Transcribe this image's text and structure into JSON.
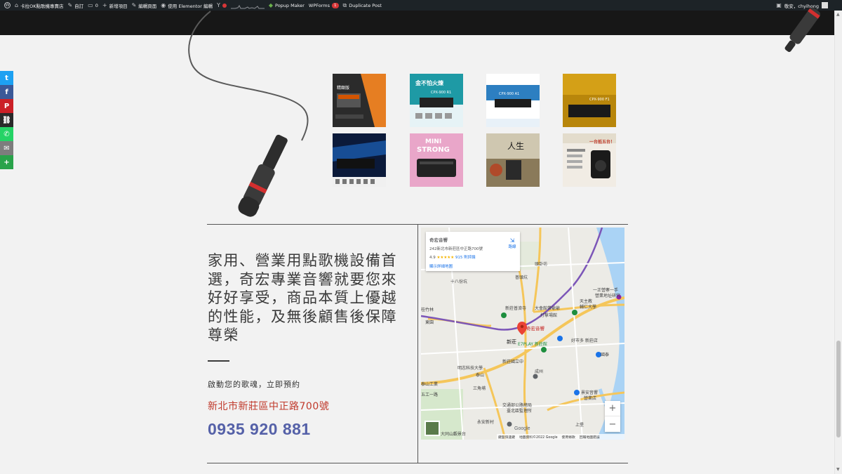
{
  "adminbar": {
    "site_name": "卡拉OK點歌機專賣店",
    "customize": "自訂",
    "comments_count": "0",
    "new_item": "新增項目",
    "edit_page": "編輯頁面",
    "elementor_edit": "使用 Elementor 編輯",
    "popup_maker": "Popup Maker",
    "wpforms": "WPForms",
    "wpforms_badge": "1",
    "duplicate_post": "Duplicate Post",
    "greeting": "敬安，chyihong"
  },
  "share_buttons": [
    {
      "name": "twitter",
      "glyph": "t",
      "color": "#1da1f2"
    },
    {
      "name": "facebook",
      "glyph": "f",
      "color": "#3b5998"
    },
    {
      "name": "pinterest",
      "glyph": "P",
      "color": "#cb2027"
    },
    {
      "name": "copy-link",
      "glyph": "⛓",
      "color": "#2a2a2a"
    },
    {
      "name": "whatsapp",
      "glyph": "✆",
      "color": "#25d366"
    },
    {
      "name": "email",
      "glyph": "✉",
      "color": "#7d7d7d"
    },
    {
      "name": "more",
      "glyph": "+",
      "color": "#29a34a"
    }
  ],
  "gallery": {
    "row1": [
      "gallery-image-1",
      "gallery-image-2",
      "gallery-image-3",
      "gallery-image-4"
    ],
    "row2": [
      "gallery-image-5",
      "gallery-image-6",
      "gallery-image-7",
      "gallery-image-8"
    ],
    "thumb_texts": {
      "t1": "精緻版",
      "t2": "金不怕火煉",
      "t2b": "CPX-900 R1",
      "t3": "CPX-900 A1",
      "t4": "CPX-900 F1",
      "t6a": "MINI",
      "t6b": "STRONG",
      "t7": "人生",
      "t8": "一台抵五台！"
    }
  },
  "contact": {
    "headline": "家用、營業用點歌機設備首選，奇宏專業音響就要您來好好享受，商品本質上優越的性能，及無後顧售後保障尊榮",
    "subline": "啟動您的歌魂，立即預約",
    "address": "新北市新莊區中正路700號",
    "phone": "0935 920 881"
  },
  "map": {
    "place_name": "奇宏音響",
    "place_address": "242新北市新莊區中正路700號",
    "rating": "4.9",
    "stars": "★★★★★",
    "reviews": "915 則評論",
    "larger_map": "顯示詳細地圖",
    "directions": "路線",
    "marker_label": "奇宏音響",
    "labels": {
      "new_taipei": "新北市立",
      "toucheng": "頭卦坊",
      "fulong": "福林",
      "st_fair": "十八份坑",
      "pu_jiang": "普頭坑",
      "tianzhu": "天主教",
      "fu_jen": "輔仁大學",
      "fu_jen2": "一正營寨一手",
      "fu_jen3": "營業地址研究",
      "xinzhuang_station": "新莊",
      "xinzhuang_school": "新莊國立中",
      "chengzhou": "成州",
      "kaishan": "凱旋",
      "mingzhi": "明志科技大學",
      "taishan": "泰山",
      "siyuan": "新莊四國小",
      "sanxia": "三角埔",
      "shuili": "好市多 新莊店",
      "e7play": "E7PLAY 新莊館",
      "chuanju": "大會館帶爺爺",
      "chuanju2": "打擊場館",
      "dongan": "東安",
      "wugu": "五股",
      "jiaotong": "交通部公路總局",
      "jiaotong2": "臺北區監理所",
      "yongan": "永安新村",
      "nanshan": "大同山觀景台",
      "xinzhuang_temple": "新莊普濟寺",
      "shuangfeng": "雙鳳",
      "huayao": "華中",
      "taishan_ind": "泰山工業",
      "taishan_ind2": "五工一路",
      "shengli": "景安音響",
      "shengli2": "營業店",
      "dingpu": "頂埔",
      "jieshou": "頂部大馬",
      "xinzhuang_sc": "新莊國",
      "sanjiaopu": "建平坊",
      "guotai": "國泰",
      "shangda": "上堡",
      "chongqing": "重慶樓",
      "bishan": "碧山",
      "hotel": "桂竹林",
      "jinxiu": "錦繡",
      "wanshou": "萬壽",
      "qingshui": "清水坑",
      "dong_yuan": "東園",
      "le_ji": "樂氣",
      "shu_lin": "樹林國小",
      "school_zhongyuan": "正大街"
    },
    "google": "Google",
    "attribution": [
      "鍵盤快速鍵",
      "地圖資料©2022 Google",
      "使用條款",
      "回報地圖錯誤"
    ]
  },
  "colors": {
    "address": "#c0392b",
    "phone": "#5561a8",
    "adminbar": "#1d2327",
    "darkband": "#171717",
    "mic_ring": "#d32f2f"
  }
}
